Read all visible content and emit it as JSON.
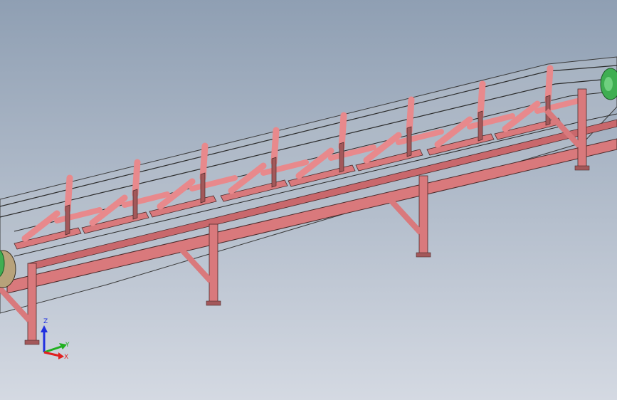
{
  "viewport": {
    "background_top": "#8f9fb3",
    "background_bottom": "#d4d9e2"
  },
  "model": {
    "frame_color": "#d9797c",
    "frame_dark": "#a3585a",
    "frame_edge": "#4a2a2a",
    "belt_fill": "#b8c2cc",
    "belt_edge": "#3a3a3a",
    "pulley_color": "#3fae52",
    "roller_color": "#e8898c"
  },
  "triad": {
    "x_label": "X",
    "y_label": "Y",
    "z_label": "Z",
    "x_color": "#e02020",
    "y_color": "#20b020",
    "z_color": "#2030e0"
  }
}
